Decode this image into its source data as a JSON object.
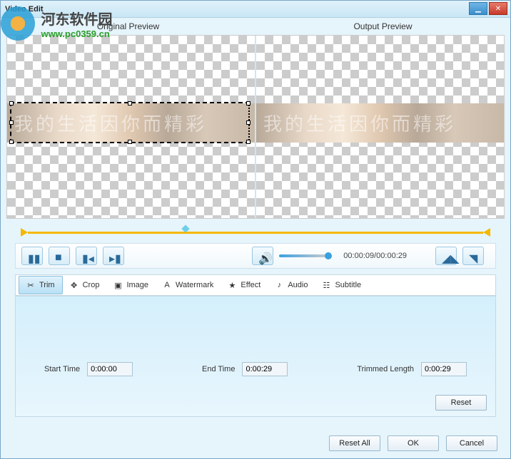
{
  "window": {
    "title": "Video Edit"
  },
  "watermark": {
    "name": "河东软件园",
    "url": "www.pc0359.cn"
  },
  "labels": {
    "original": "Original Preview",
    "output": "Output Preview"
  },
  "preview_text": "我的生活因你而精彩",
  "playback": {
    "time": "00:00:09/00:00:29"
  },
  "tabs": [
    {
      "icon": "scissors-icon",
      "label": "Trim",
      "active": true
    },
    {
      "icon": "crop-icon",
      "label": "Crop",
      "active": false
    },
    {
      "icon": "image-icon",
      "label": "Image",
      "active": false
    },
    {
      "icon": "font-icon",
      "label": "Watermark",
      "active": false
    },
    {
      "icon": "star-icon",
      "label": "Effect",
      "active": false
    },
    {
      "icon": "note-icon",
      "label": "Audio",
      "active": false
    },
    {
      "icon": "subtitle-icon",
      "label": "Subtitle",
      "active": false
    }
  ],
  "trim": {
    "start_label": "Start Time",
    "start_value": "0:00:00",
    "end_label": "End Time",
    "end_value": "0:00:29",
    "length_label": "Trimmed Length",
    "length_value": "0:00:29",
    "reset": "Reset"
  },
  "buttons": {
    "reset_all": "Reset All",
    "ok": "OK",
    "cancel": "Cancel"
  }
}
